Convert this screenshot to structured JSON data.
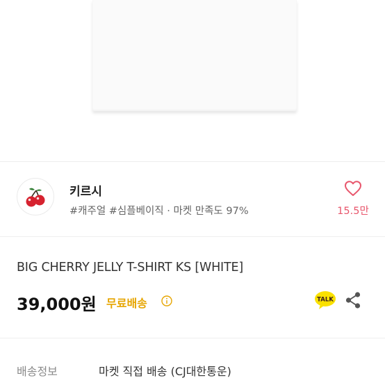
{
  "shop": {
    "name": "키르시",
    "tags": "#캐주얼 #심플베이직 · 마켓 만족도 97%",
    "avatar_icon": "cherry-logo-icon",
    "likes": "15.5만",
    "like_icon": "heart-outline-icon"
  },
  "product": {
    "title": "BIG CHERRY JELLY T-SHIRT KS [WHITE]",
    "price": "39,000원",
    "shipping_badge": "무료배송",
    "info_icon": "info-circle-icon",
    "kakao_label": "TALK",
    "share_icon": "share-icon"
  },
  "delivery": {
    "label": "배송정보",
    "value": "마켓 직접 배송 (CJ대한통운)"
  },
  "colors": {
    "accent_pink": "#e8566c",
    "shipping_yellow": "#e6a500",
    "kakao_yellow": "#fae100",
    "cherry_red": "#d6222f"
  }
}
